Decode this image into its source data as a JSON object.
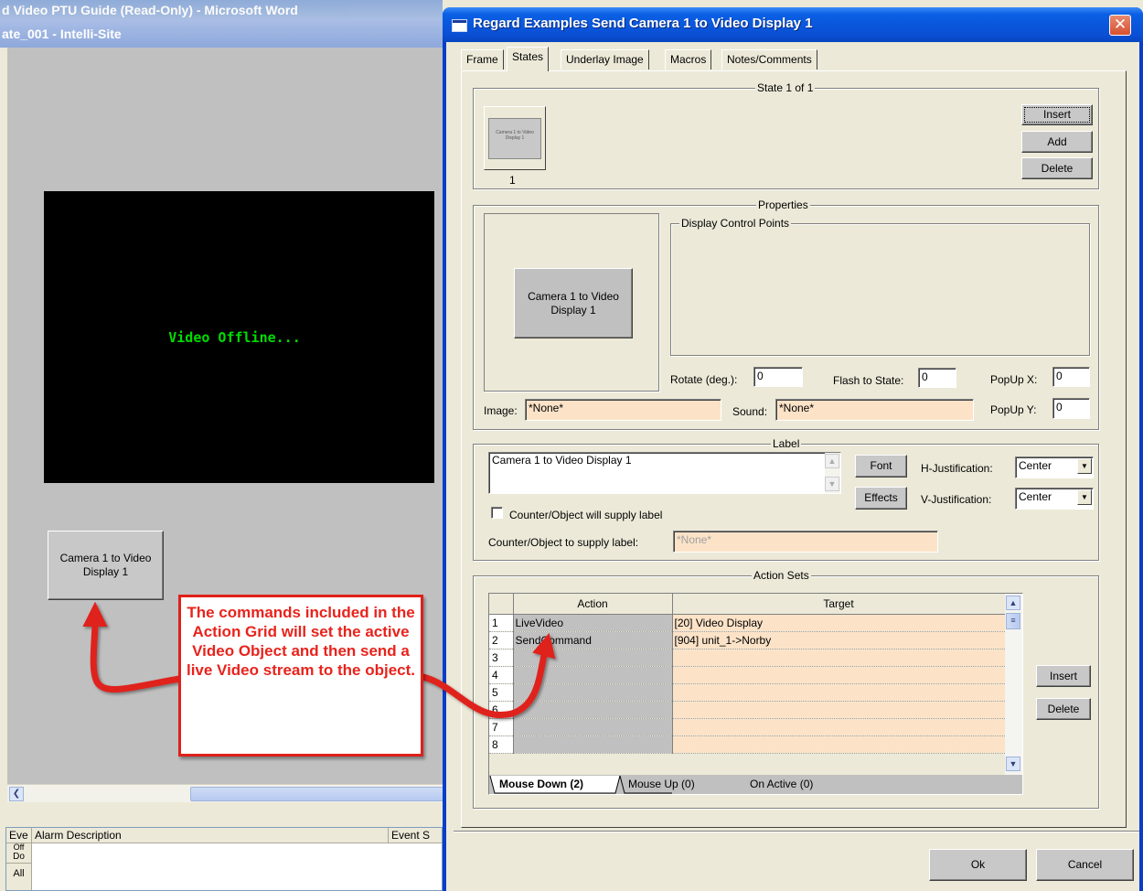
{
  "background_app": {
    "word_title": "d Video PTU Guide (Read-Only) - Microsoft Word",
    "app_title": "ate_001 - Intelli-Site",
    "video_status": "Video Offline...",
    "camera_button_label": "Camera 1 to Video Display 1",
    "alarm_grid": {
      "columns": [
        "Eve",
        "Alarm Description",
        "Event S"
      ],
      "side_labels": [
        "Off",
        "Do",
        "All"
      ]
    }
  },
  "dialog": {
    "title": "Regard Examples Send Camera 1 to Video Display 1",
    "tabs": [
      {
        "label": "Frame",
        "active": false
      },
      {
        "label": "States",
        "active": true
      },
      {
        "label": "Underlay Image",
        "active": false
      },
      {
        "label": "Macros",
        "active": false
      },
      {
        "label": "Notes/Comments",
        "active": false
      }
    ],
    "states": {
      "legend": "State 1 of 1",
      "thumbnail_text": "Camera 1 to Video Display 1",
      "thumbnail_number": "1",
      "buttons": {
        "insert": "Insert",
        "add": "Add",
        "delete": "Delete"
      }
    },
    "properties": {
      "legend": "Properties",
      "preview_label": "Camera 1 to Video Display 1",
      "display_control_points_legend": "Display Control Points",
      "rotate_label": "Rotate (deg.):",
      "rotate_value": "0",
      "flash_label": "Flash to State:",
      "flash_value": "0",
      "popup_x_label": "PopUp X:",
      "popup_x_value": "0",
      "popup_y_label": "PopUp Y:",
      "popup_y_value": "0",
      "image_label": "Image:",
      "image_value": "*None*",
      "sound_label": "Sound:",
      "sound_value": "*None*"
    },
    "label_section": {
      "legend": "Label",
      "text": "Camera 1 to Video Display 1",
      "font_button": "Font",
      "effects_button": "Effects",
      "h_just_label": "H-Justification:",
      "h_just_value": "Center",
      "v_just_label": "V-Justification:",
      "v_just_value": "Center",
      "counter_checkbox_label": "Counter/Object will supply label",
      "counter_checkbox_checked": false,
      "counter_field_label": "Counter/Object to supply label:",
      "counter_field_value": "*None*"
    },
    "action_sets": {
      "legend": "Action Sets",
      "columns": {
        "action": "Action",
        "target": "Target"
      },
      "rows": [
        {
          "num": "1",
          "action": "LiveVideo",
          "target": "[20] Video Display"
        },
        {
          "num": "2",
          "action": "SendCommand",
          "target": "[904] unit_1->Norby"
        },
        {
          "num": "3",
          "action": "",
          "target": ""
        },
        {
          "num": "4",
          "action": "",
          "target": ""
        },
        {
          "num": "5",
          "action": "",
          "target": ""
        },
        {
          "num": "6",
          "action": "",
          "target": ""
        },
        {
          "num": "7",
          "action": "",
          "target": ""
        },
        {
          "num": "8",
          "action": "",
          "target": ""
        }
      ],
      "insert_button": "Insert",
      "delete_button": "Delete",
      "event_tabs": [
        {
          "label": "Mouse Down (2)",
          "active": true
        },
        {
          "label": "Mouse Up (0)",
          "active": false
        },
        {
          "label": "On Active (0)",
          "active": false
        }
      ]
    },
    "ok_button": "Ok",
    "cancel_button": "Cancel"
  },
  "annotation": {
    "text": "The commands included in the Action Grid will set the active Video Object and then send a live Video stream to the object.",
    "color": "#e8231c"
  },
  "colors": {
    "titlebar": "#0a4fd4",
    "close_button": "#d7502f",
    "window_face": "#ece9d8",
    "peach_field": "#fce3c8",
    "video_text": "#00dd00"
  }
}
